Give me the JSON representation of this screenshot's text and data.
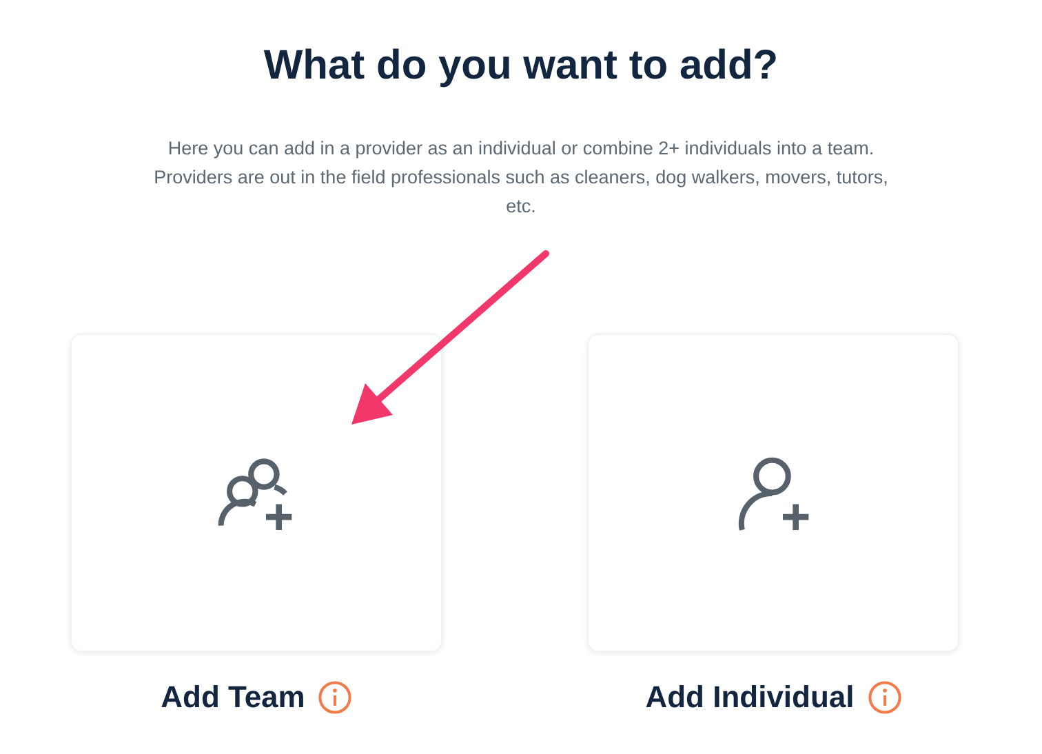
{
  "heading": "What do you want to add?",
  "description": "Here you can add in a provider as an individual or combine 2+ individuals into a team. Providers are out in the field professionals such as cleaners, dog walkers, movers, tutors, etc.",
  "options": [
    {
      "kind": "team",
      "label": "Add Team"
    },
    {
      "kind": "individual",
      "label": "Add Individual"
    }
  ]
}
